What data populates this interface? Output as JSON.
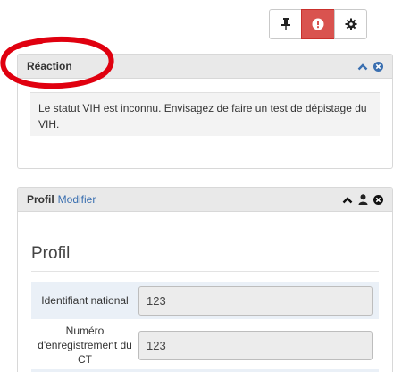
{
  "toolbar": {
    "buttons": [
      {
        "icon": "pin-icon"
      },
      {
        "icon": "alert-icon",
        "color": "#d9534f"
      },
      {
        "icon": "gear-icon"
      }
    ]
  },
  "reaction": {
    "title": "Réaction",
    "message": "Le statut VIH est inconnu. Envisagez de faire un test de dépistage du VIH."
  },
  "profil": {
    "title": "Profil",
    "edit_link": "Modifier",
    "heading": "Profil",
    "fields": [
      {
        "label": "Identifiant national",
        "value": "123"
      },
      {
        "label": "Numéro d'enregistrement du CT",
        "value": "123"
      }
    ]
  },
  "colors": {
    "accent_link": "#3a6fb0",
    "alert": "#d9534f",
    "annotation": "#e0000f"
  }
}
